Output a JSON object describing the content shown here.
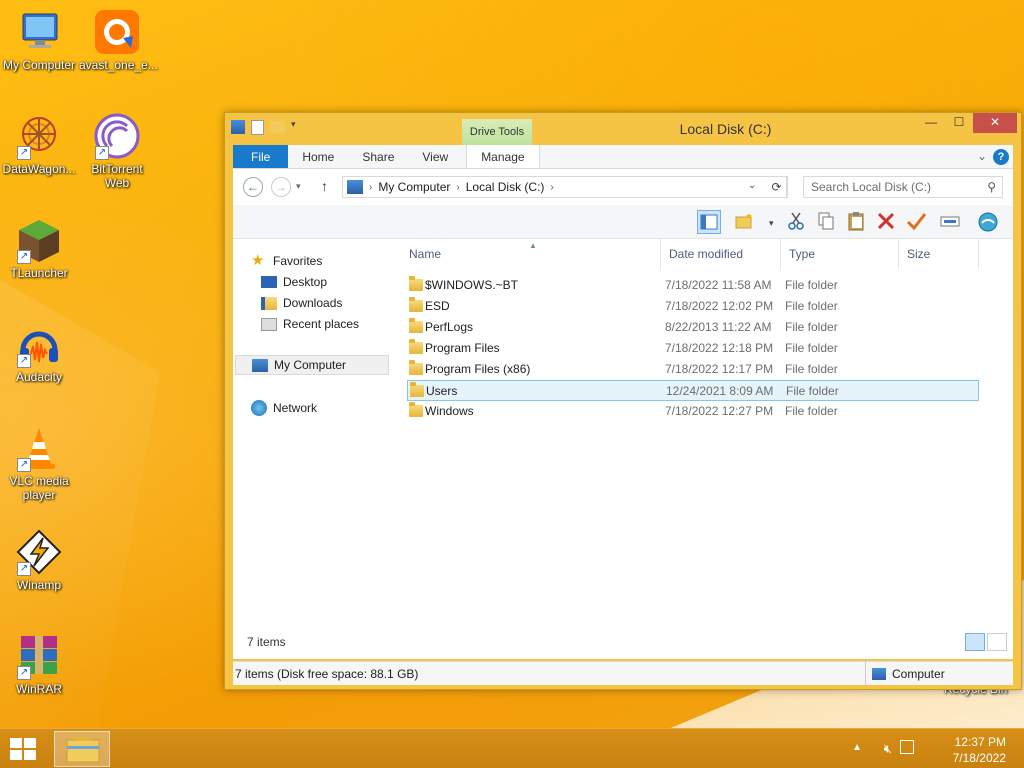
{
  "desktop": {
    "icons": [
      {
        "label": "My Computer"
      },
      {
        "label": "avast_one_e..."
      },
      {
        "label": "DataWagon..."
      },
      {
        "label": "BitTorrent Web"
      },
      {
        "label": "TLauncher"
      },
      {
        "label": "Audacity"
      },
      {
        "label": "VLC media player"
      },
      {
        "label": "Winamp"
      },
      {
        "label": "WinRAR"
      }
    ],
    "recycle_bin_label": "Recycle Bin"
  },
  "window": {
    "title": "Local Disk (C:)",
    "context_tab_group": "Drive Tools",
    "ribbon_tabs": [
      "File",
      "Home",
      "Share",
      "View",
      "Manage"
    ],
    "address": {
      "segments": [
        "My Computer",
        "Local Disk (C:)"
      ]
    },
    "search": {
      "placeholder": "Search Local Disk (C:)"
    },
    "navigation": {
      "favorites": "Favorites",
      "desktop": "Desktop",
      "downloads": "Downloads",
      "recent": "Recent places",
      "computer": "My Computer",
      "network": "Network"
    },
    "columns": {
      "name": "Name",
      "date": "Date modified",
      "type": "Type",
      "size": "Size"
    },
    "files": [
      {
        "name": "$WINDOWS.~BT",
        "date": "7/18/2022 11:58 AM",
        "type": "File folder"
      },
      {
        "name": "ESD",
        "date": "7/18/2022 12:02 PM",
        "type": "File folder"
      },
      {
        "name": "PerfLogs",
        "date": "8/22/2013 11:22 AM",
        "type": "File folder"
      },
      {
        "name": "Program Files",
        "date": "7/18/2022 12:18 PM",
        "type": "File folder"
      },
      {
        "name": "Program Files (x86)",
        "date": "7/18/2022 12:17 PM",
        "type": "File folder"
      },
      {
        "name": "Users",
        "date": "12/24/2021 8:09 AM",
        "type": "File folder"
      },
      {
        "name": "Windows",
        "date": "7/18/2022 12:27 PM",
        "type": "File folder"
      }
    ],
    "selected_file": "Users",
    "item_count": "7 items",
    "status_left": "7 items (Disk free space: 88.1 GB)",
    "status_right": "Computer"
  },
  "taskbar": {
    "time": "12:37 PM",
    "date": "7/18/2022"
  },
  "colors": {
    "desktop_bg": "#f7ad09",
    "file_tab": "#1979ca",
    "selection": "#e5f3fb",
    "close_button": "#c7504a"
  }
}
